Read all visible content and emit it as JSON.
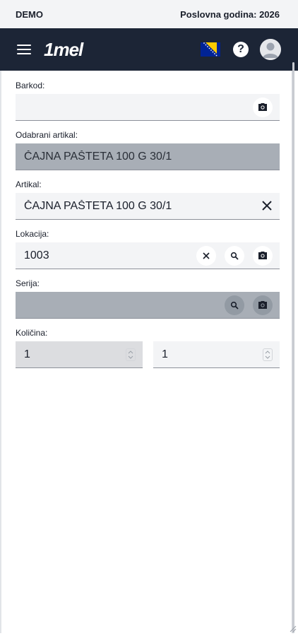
{
  "topbar": {
    "company": "DEMO",
    "year_label": "Poslovna godina: 2026"
  },
  "navbar": {
    "logo": "1mel",
    "icons": [
      "menu-icon",
      "bosnia-flag-icon",
      "help-icon",
      "avatar-icon"
    ],
    "help_glyph": "?"
  },
  "form": {
    "barkod": {
      "label": "Barkod:",
      "value": ""
    },
    "odabrani": {
      "label": "Odabrani artikal:",
      "value": "ČAJNA PAŠTETA 100 G 30/1"
    },
    "artikal": {
      "label": "Artikal:",
      "value": "ČAJNA PAŠTETA 100 G 30/1"
    },
    "lokacija": {
      "label": "Lokacija:",
      "value": "1003"
    },
    "serija": {
      "label": "Serija:",
      "value": ""
    },
    "kolicina": {
      "label": "Količina:",
      "value1": "1",
      "value2": "1"
    }
  },
  "colors": {
    "navbar": "#1c2536",
    "disabled_field": "#a8aeb6",
    "field_bg": "#f3f4f6"
  }
}
